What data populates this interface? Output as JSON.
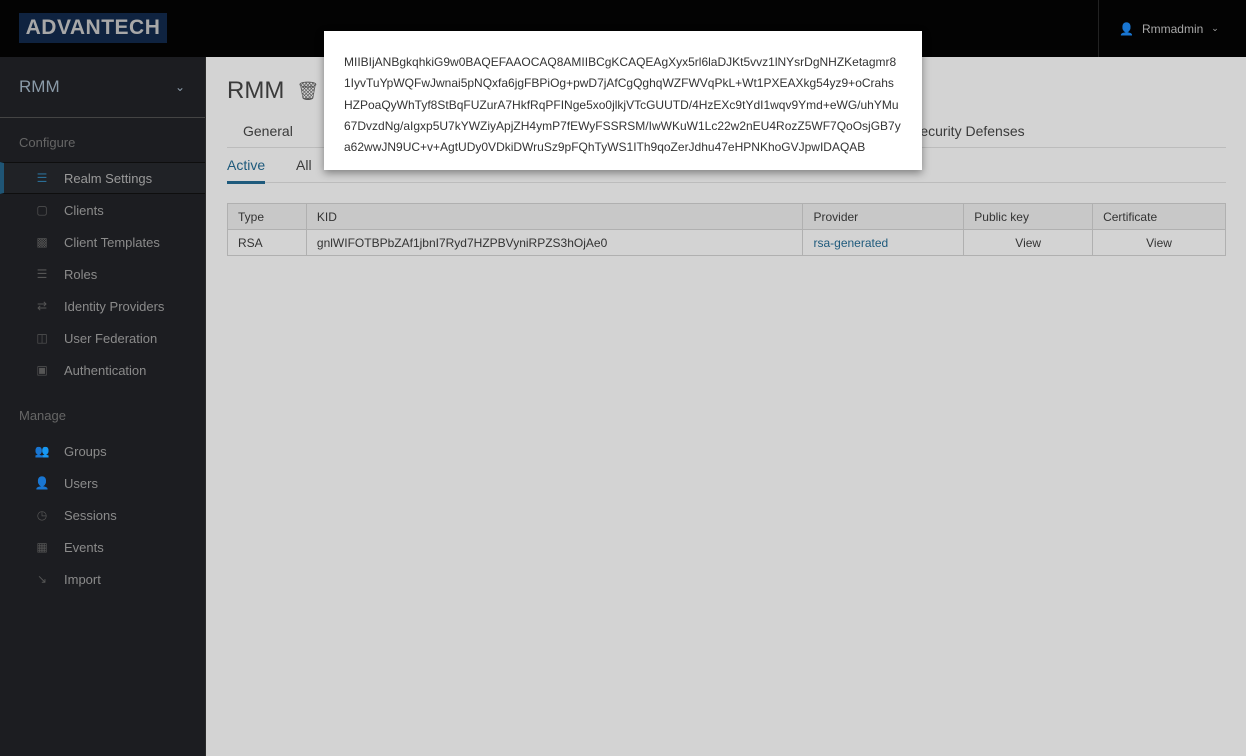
{
  "header": {
    "logo": "ADVANTECH",
    "user": "Rmmadmin"
  },
  "sidebar": {
    "realm": "RMM",
    "configure_label": "Configure",
    "manage_label": "Manage",
    "configure": [
      {
        "label": "Realm Settings",
        "icon": "sliders-icon"
      },
      {
        "label": "Clients",
        "icon": "cube-icon"
      },
      {
        "label": "Client Templates",
        "icon": "cubes-icon"
      },
      {
        "label": "Roles",
        "icon": "list-icon"
      },
      {
        "label": "Identity Providers",
        "icon": "exchange-icon"
      },
      {
        "label": "User Federation",
        "icon": "database-icon"
      },
      {
        "label": "Authentication",
        "icon": "lock-icon"
      }
    ],
    "manage": [
      {
        "label": "Groups",
        "icon": "users-icon"
      },
      {
        "label": "Users",
        "icon": "user-icon"
      },
      {
        "label": "Sessions",
        "icon": "clock-icon"
      },
      {
        "label": "Events",
        "icon": "calendar-icon"
      },
      {
        "label": "Import",
        "icon": "import-icon"
      }
    ]
  },
  "main": {
    "title": "RMM",
    "tabs": [
      "General",
      "Security Defenses"
    ],
    "subtabs": [
      "Active",
      "All"
    ],
    "table": {
      "headers": [
        "Type",
        "KID",
        "Provider",
        "Public key",
        "Certificate"
      ],
      "rows": [
        [
          "RSA",
          "gnlWIFOTBPbZAf1jbnI7Ryd7HZPBVyniRPZS3hOjAe0",
          "rsa-generated",
          "View",
          "View"
        ]
      ]
    }
  },
  "popup": {
    "text": "MIIBIjANBgkqhkiG9w0BAQEFAAOCAQ8AMIIBCgKCAQEAgXyx5rl6laDJKt5vvz1lNYsrDgNHZKetagmr81IyvTuYpWQFwJwnai5pNQxfa6jgFBPiOg+pwD7jAfCgQghqWZFWVqPkL+Wt1PXEAXkg54yz9+oCrahsHZPoaQyWhTyf8StBqFUZurA7HkfRqPFINge5xo0jlkjVTcGUUTD/4HzEXc9tYdI1wqv9Ymd+eWG/uhYMu67DvzdNg/aIgxp5U7kYWZiyApjZH4ymP7fEWyFSSRSM/IwWKuW1Lc22w2nEU4RozZ5WF7QoOsjGB7ya62wwJN9UC+v+AgtUDy0VDkiDWruSz9pFQhTyWS1ITh9qoZerJdhu47eHPNKhoGVJpwIDAQAB"
  }
}
